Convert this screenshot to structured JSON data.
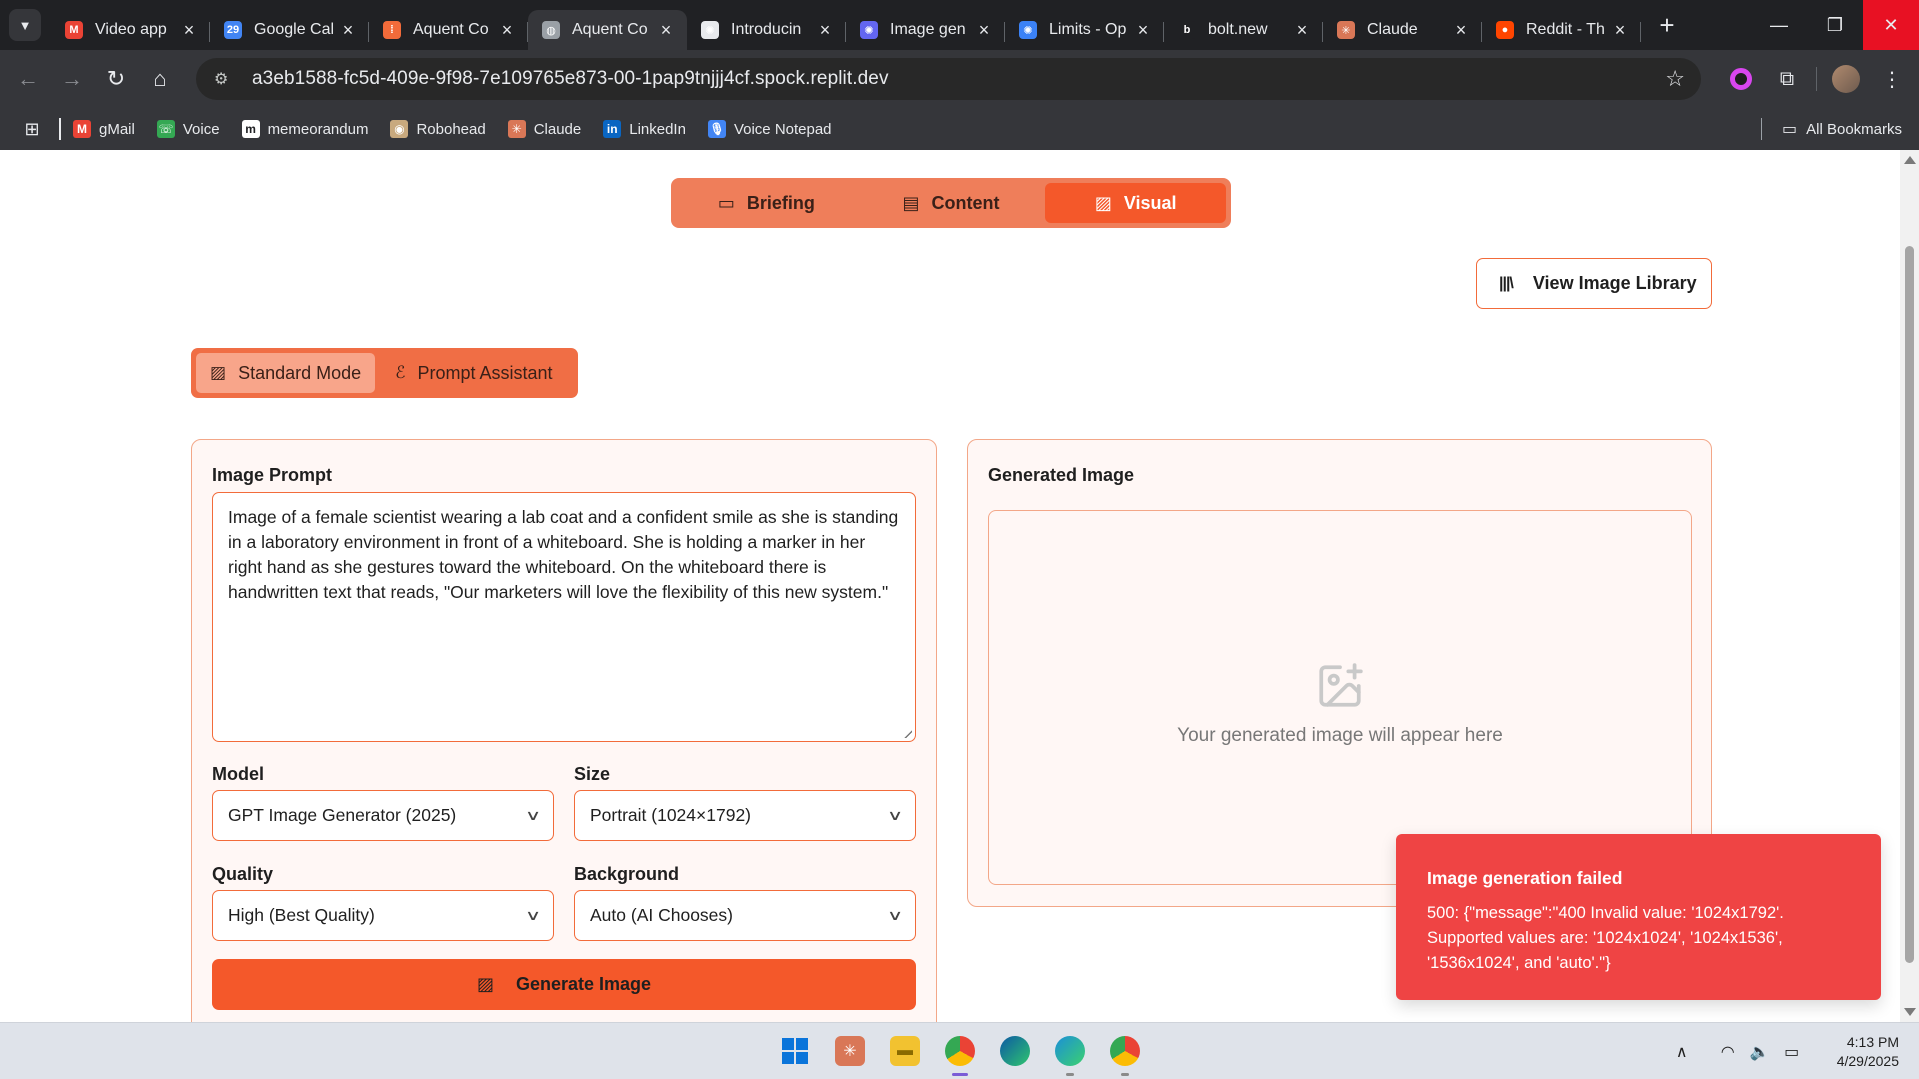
{
  "browser": {
    "tabs": [
      {
        "title": "Video app",
        "favicon": "gmail-icon",
        "color": "#ea4335",
        "glyph": "M",
        "active": false
      },
      {
        "title": "Google Cal",
        "favicon": "calendar-icon",
        "color": "#4285f4",
        "glyph": "29",
        "active": false
      },
      {
        "title": "Aquent Co",
        "favicon": "aquent-icon",
        "color": "#f26b3a",
        "glyph": "⁞",
        "active": false
      },
      {
        "title": "Aquent Co",
        "favicon": "globe-icon",
        "color": "#9aa0a6",
        "glyph": "◍",
        "active": true
      },
      {
        "title": "Introducin",
        "favicon": "openai-icon",
        "color": "#e8eaed",
        "glyph": "✺",
        "active": false
      },
      {
        "title": "Image gen",
        "favicon": "openai-icon",
        "color": "#6366f1",
        "glyph": "✺",
        "active": false
      },
      {
        "title": "Limits - Op",
        "favicon": "openai-icon",
        "color": "#3b82f6",
        "glyph": "✺",
        "active": false
      },
      {
        "title": "bolt.new",
        "favicon": "bolt-icon",
        "color": "#202124",
        "glyph": "b",
        "active": false
      },
      {
        "title": "Claude",
        "favicon": "claude-icon",
        "color": "#d97757",
        "glyph": "✳",
        "active": false
      },
      {
        "title": "Reddit - Th",
        "favicon": "reddit-icon",
        "color": "#ff4500",
        "glyph": "●",
        "active": false
      }
    ],
    "url": "a3eb1588-fc5d-409e-9f98-7e109765e873-00-1pap9tnjjj4cf.spock.replit.dev",
    "bookmarks": [
      {
        "label": "gMail",
        "icon": "gmail-icon",
        "color": "#ea4335",
        "glyph": "M"
      },
      {
        "label": "Voice",
        "icon": "voice-icon",
        "color": "#34a853",
        "glyph": "☏"
      },
      {
        "label": "memeorandum",
        "icon": "memeorandum-icon",
        "color": "#ffffff",
        "glyph": "m"
      },
      {
        "label": "Robohead",
        "icon": "robohead-icon",
        "color": "#c8a97e",
        "glyph": "◉"
      },
      {
        "label": "Claude",
        "icon": "claude-icon",
        "color": "#d97757",
        "glyph": "✳"
      },
      {
        "label": "LinkedIn",
        "icon": "linkedin-icon",
        "color": "#0a66c2",
        "glyph": "in"
      },
      {
        "label": "Voice Notepad",
        "icon": "microphone-icon",
        "color": "#4285f4",
        "glyph": "🎙"
      }
    ],
    "all_bookmarks": "All Bookmarks"
  },
  "app": {
    "main_tabs": [
      {
        "label": "Briefing",
        "icon": "message-square-icon",
        "glyph": "▭",
        "active": false
      },
      {
        "label": "Content",
        "icon": "file-text-icon",
        "glyph": "▤",
        "active": false
      },
      {
        "label": "Visual",
        "icon": "image-icon",
        "glyph": "▨",
        "active": true
      }
    ],
    "library_button": "View Image Library",
    "modes": [
      {
        "label": "Standard Mode",
        "icon": "image-plus-icon",
        "glyph": "▨",
        "active": true
      },
      {
        "label": "Prompt Assistant",
        "icon": "brain-icon",
        "glyph": "ℰ",
        "active": false
      }
    ],
    "form": {
      "prompt_label": "Image Prompt",
      "prompt_value": "Image of a female scientist wearing a lab coat and a confident smile as she is standing in a laboratory environment in front of a whiteboard. She is holding a marker in her right hand as she gestures toward the whiteboard. On the whiteboard there is handwritten text that reads, \"Our marketers will love the flexibility of this new system.\"",
      "model_label": "Model",
      "model_value": "GPT Image Generator (2025)",
      "size_label": "Size",
      "size_value": "Portrait (1024×1792)",
      "quality_label": "Quality",
      "quality_value": "High (Best Quality)",
      "background_label": "Background",
      "background_value": "Auto (AI Chooses)",
      "generate_label": "Generate Image"
    },
    "output": {
      "title": "Generated Image",
      "placeholder": "Your generated image will appear here"
    },
    "toast": {
      "title": "Image generation failed",
      "message": "500: {\"message\":\"400 Invalid value: '1024x1792'. Supported values are: '1024x1024', '1024x1536', '1536x1024', and 'auto'.\"}"
    },
    "accent": "#f4582a",
    "error_color": "#ef4444"
  },
  "taskbar": {
    "time": "4:13 PM",
    "date": "4/29/2025"
  }
}
